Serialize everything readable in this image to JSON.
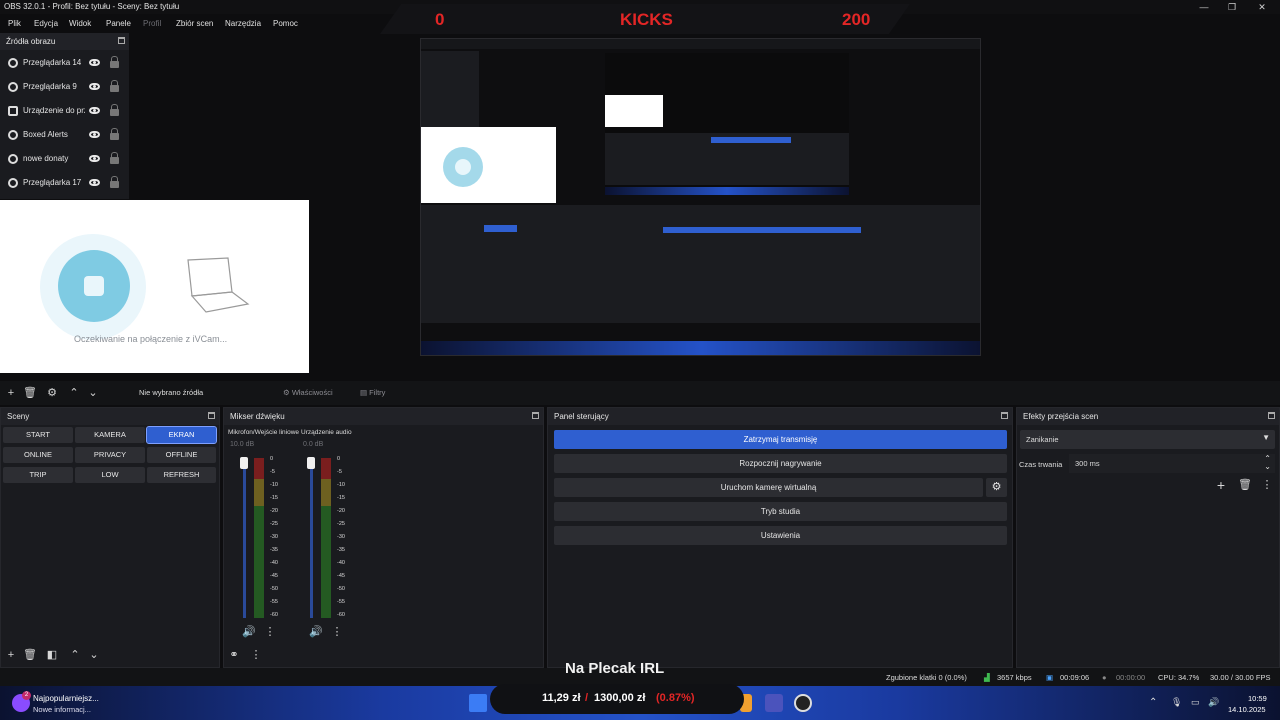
{
  "window": {
    "title": "OBS 32.0.1 - Profil: Bez tytułu - Sceny: Bez tytułu",
    "controls": [
      "minimize-icon",
      "maximize-icon",
      "close-icon"
    ]
  },
  "menu": [
    "Plik",
    "Edycja",
    "Widok",
    "Panele",
    "Profil",
    "Zbiór scen",
    "Narzędzia",
    "Pomoc"
  ],
  "overlay": {
    "left_value": "0",
    "center_label": "KICKS",
    "right_value": "200",
    "accent": "#e32626"
  },
  "sources": {
    "title": "Źródła obrazu",
    "items": [
      {
        "label": "Przeglądarka 14",
        "icon": "globe-icon"
      },
      {
        "label": "Przeglądarka 9",
        "icon": "globe-icon"
      },
      {
        "label": "Urządzenie do przechwytywania",
        "icon": "camera-icon"
      },
      {
        "label": "Boxed Alerts",
        "icon": "globe-icon"
      },
      {
        "label": "nowe donaty",
        "icon": "globe-icon"
      },
      {
        "label": "Przeglądarka 17",
        "icon": "globe-icon"
      }
    ]
  },
  "ivcam": {
    "waiting_text": "Oczekiwanie na połączenie z iVCam..."
  },
  "source_toolbar": {
    "selection": "Nie wybrano źródła",
    "properties": "Właściwości",
    "filters": "Filtry"
  },
  "scenes": {
    "title": "Sceny",
    "buttons": [
      {
        "label": "START",
        "active": false
      },
      {
        "label": "KAMERA",
        "active": false
      },
      {
        "label": "EKRAN",
        "active": true
      },
      {
        "label": "ONLINE",
        "active": false
      },
      {
        "label": "PRIVACY",
        "active": false
      },
      {
        "label": "OFFLINE",
        "active": false
      },
      {
        "label": "TRIP",
        "active": false
      },
      {
        "label": "LOW",
        "active": false
      },
      {
        "label": "REFRESH",
        "active": false
      }
    ]
  },
  "mixer": {
    "title": "Mikser dźwięku",
    "channels": [
      {
        "name": "Mikrofon/Wejście liniowe",
        "level": "10.0 dB"
      },
      {
        "name": "Urządzenie audio",
        "level": "0.0 dB"
      }
    ],
    "ticks": [
      "0",
      "-5",
      "-10",
      "-15",
      "-20",
      "-25",
      "-30",
      "-35",
      "-40",
      "-45",
      "-50",
      "-55",
      "-60"
    ]
  },
  "controls": {
    "title": "Panel sterujący",
    "buttons": [
      "Zatrzymaj transmisję",
      "Rozpocznij nagrywanie",
      "Uruchom kamerę wirtualną",
      "Tryb studia",
      "Ustawienia"
    ]
  },
  "transitions": {
    "title": "Efekty przejścia scen",
    "selected": "Zanikanie",
    "duration_label": "Czas trwania",
    "duration_value": "300 ms"
  },
  "overlay_bottom": {
    "stream_title": "Na Plecak IRL"
  },
  "price": {
    "current": "11,29 zł",
    "separator": "/",
    "target": "1300,00 zł",
    "percent": "(0.87%)"
  },
  "statusbar": {
    "dropped": "Zgubione klatki 0 (0.0%)",
    "bitrate": "3657 kbps",
    "stream_time": "00:09:06",
    "record_time": "00:00:00",
    "cpu": "CPU: 34.7%",
    "fps": "30.00 / 30.00 FPS"
  },
  "taskbar": {
    "notification_title": "Najpopularniejsz...",
    "notification_sub": "Nowe informacj...",
    "notification_badge": "2",
    "time": "10:59",
    "date": "14.10.2025"
  }
}
